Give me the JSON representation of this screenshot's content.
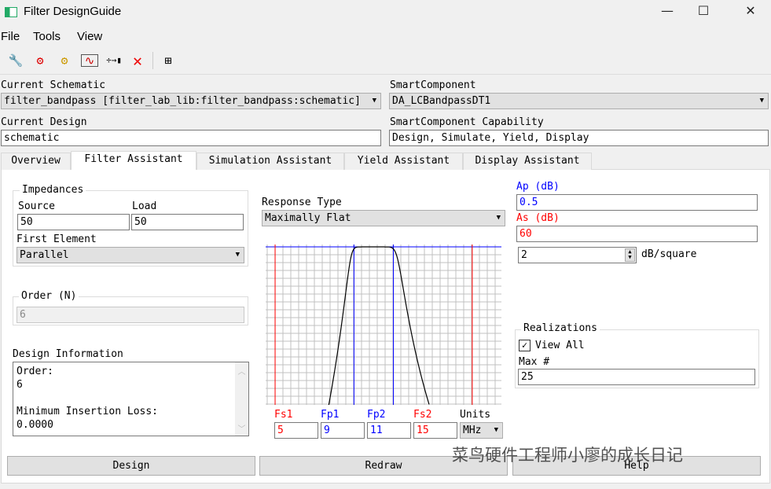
{
  "window": {
    "title": "Filter DesignGuide",
    "minimize": "—",
    "maximize": "☐",
    "close": "✕"
  },
  "menu": [
    "File",
    "Tools",
    "View"
  ],
  "toolbar": [
    {
      "icon": "wrench-icon",
      "glyph": "🔧"
    },
    {
      "icon": "gears-icon",
      "glyph": "⚙"
    },
    {
      "icon": "gears-wrench-icon",
      "glyph": "⚙"
    },
    {
      "icon": "plot-icon",
      "glyph": "∿"
    },
    {
      "icon": "component-icon",
      "glyph": "÷→▮"
    },
    {
      "icon": "delete-icon",
      "glyph": "✕"
    },
    {
      "icon": "grid-icon",
      "glyph": "⊞"
    }
  ],
  "schematic": {
    "label": "Current Schematic",
    "value": "filter_bandpass [filter_lab_lib:filter_bandpass:schematic]"
  },
  "smart_component": {
    "label": "SmartComponent",
    "value": "DA_LCBandpassDT1"
  },
  "design": {
    "label": "Current Design",
    "value": "schematic"
  },
  "capability": {
    "label": "SmartComponent Capability",
    "value": "Design, Simulate, Yield, Display"
  },
  "tabs": [
    "Overview",
    "Filter Assistant",
    "Simulation Assistant",
    "Yield Assistant",
    "Display Assistant"
  ],
  "impedances": {
    "title": "Impedances",
    "source_label": "Source",
    "source": "50",
    "load_label": "Load",
    "load": "50",
    "first_element_label": "First Element",
    "first_element": "Parallel"
  },
  "order": {
    "title": "Order (N)",
    "value": "6"
  },
  "design_info": {
    "title": "Design Information",
    "lines": [
      "Order:",
      "6",
      "",
      "Minimum Insertion Loss:",
      "0.0000"
    ]
  },
  "response": {
    "label": "Response Type",
    "value": "Maximally Flat"
  },
  "ap": {
    "label": "Ap (dB)",
    "value": "0.5"
  },
  "as": {
    "label": "As (dB)",
    "value": "60"
  },
  "scale": {
    "value": "2",
    "unit": "dB/square"
  },
  "realizations": {
    "title": "Realizations",
    "view_all": "View All",
    "view_all_checked": true,
    "max_label": "Max #",
    "max": "25"
  },
  "freqs": {
    "fs1_label": "Fs1",
    "fs1": "5",
    "fp1_label": "Fp1",
    "fp1": "9",
    "fp2_label": "Fp2",
    "fp2": "11",
    "fs2_label": "Fs2",
    "fs2": "15",
    "units_label": "Units",
    "units": "MHz"
  },
  "buttons": {
    "design": "Design",
    "redraw": "Redraw",
    "help": "Help"
  },
  "watermark": "菜鸟硬件工程师小廖的成长日记",
  "colors": {
    "stop": "#ff0000",
    "pass": "#0000ff",
    "grid": "#c0c0c0",
    "curve": "#000000"
  },
  "chart_data": {
    "type": "line",
    "xlim": [
      4.52,
      16.48
    ],
    "ylim": [
      -0.6,
      39.6
    ],
    "grid": true,
    "y_units_per_square": 2,
    "markers": [
      {
        "name": "Fs1",
        "x": 5,
        "color": "#ff0000"
      },
      {
        "name": "Fp1",
        "x": 9,
        "color": "#0000ff"
      },
      {
        "name": "Fp2",
        "x": 11,
        "color": "#0000ff"
      },
      {
        "name": "Fs2",
        "x": 15,
        "color": "#ff0000"
      }
    ],
    "hline": 0,
    "order": 6,
    "ap": 0.5
  }
}
